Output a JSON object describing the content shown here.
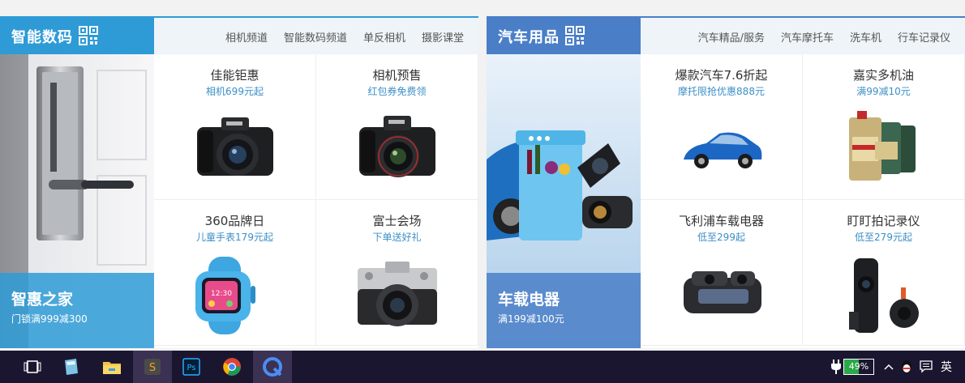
{
  "left": {
    "category": "智能数码",
    "nav": [
      "相机频道",
      "智能数码频道",
      "单反相机",
      "摄影课堂"
    ],
    "banner": {
      "title": "智惠之家",
      "subtitle": "门锁满999减300"
    },
    "items": [
      {
        "title": "佳能钜惠",
        "subtitle": "相机699元起"
      },
      {
        "title": "相机预售",
        "subtitle": "红包券免费领"
      },
      {
        "title": "360品牌日",
        "subtitle": "儿童手表179元起"
      },
      {
        "title": "富士会场",
        "subtitle": "下单送好礼"
      }
    ]
  },
  "right": {
    "category": "汽车用品",
    "nav": [
      "汽车精品/服务",
      "汽车摩托车",
      "洗车机",
      "行车记录仪"
    ],
    "banner": {
      "title": "车载电器",
      "subtitle": "满199减100元"
    },
    "items": [
      {
        "title": "爆款汽车7.6折起",
        "subtitle": "摩托限抢优惠888元"
      },
      {
        "title": "嘉实多机油",
        "subtitle": "满99减10元"
      },
      {
        "title": "飞利浦车载电器",
        "subtitle": "低至299起"
      },
      {
        "title": "盯盯拍记录仪",
        "subtitle": "低至279元起"
      }
    ]
  },
  "taskbar": {
    "battery_percent": 49,
    "battery_label": "49%",
    "ime": "英",
    "apps": [
      "task-view-icon",
      "notes-icon",
      "file-explorer-icon",
      "sublime-text-icon",
      "photoshop-icon",
      "chrome-icon",
      "browser-icon"
    ]
  }
}
